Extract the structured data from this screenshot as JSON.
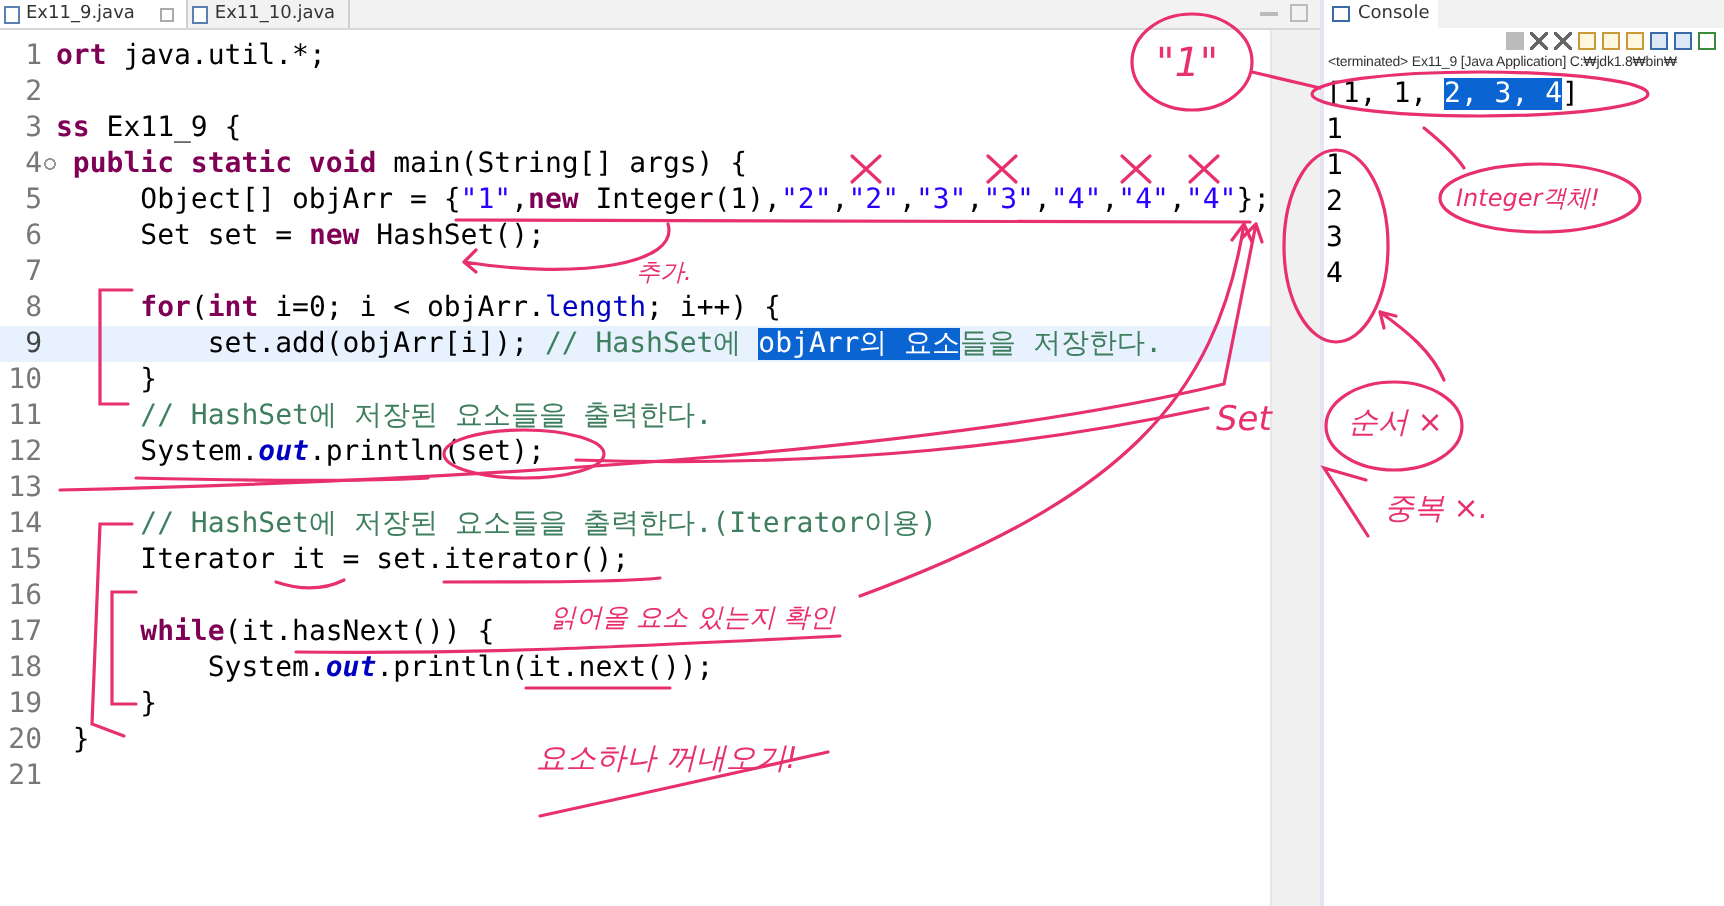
{
  "editor": {
    "tabs": [
      {
        "label": "Ex11_9.java",
        "selected": true,
        "closable": true
      },
      {
        "label": "Ex11_10.java",
        "selected": false,
        "closable": false
      }
    ],
    "lines": [
      {
        "number": "1",
        "current": false,
        "foldable": false,
        "tokens": [
          {
            "kind": "keyword",
            "text": "ort"
          },
          {
            "kind": "plain",
            "text": " java.util.*;"
          }
        ]
      },
      {
        "number": "2",
        "current": false,
        "foldable": false
      },
      {
        "number": "3",
        "current": false,
        "foldable": false,
        "tokens": [
          {
            "kind": "keyword",
            "text": "ss"
          },
          {
            "kind": "plain",
            "text": " Ex11_9 {"
          }
        ]
      },
      {
        "number": "4",
        "current": false,
        "foldable": true,
        "tokens": [
          {
            "kind": "keyword",
            "text": " public static void"
          },
          {
            "kind": "plain",
            "text": " main(String[] args) {"
          }
        ]
      },
      {
        "number": "5",
        "current": false,
        "foldable": false,
        "tokens": [
          {
            "kind": "plain",
            "text": "     Object[] objArr = {"
          },
          {
            "kind": "string",
            "text": "\"1\""
          },
          {
            "kind": "plain",
            "text": ","
          },
          {
            "kind": "keyword",
            "text": "new"
          },
          {
            "kind": "plain",
            "text": " Integer(1),"
          },
          {
            "kind": "string",
            "text": "\"2\""
          },
          {
            "kind": "plain",
            "text": ","
          },
          {
            "kind": "string",
            "text": "\"2\""
          },
          {
            "kind": "plain",
            "text": ","
          },
          {
            "kind": "string",
            "text": "\"3\""
          },
          {
            "kind": "plain",
            "text": ","
          },
          {
            "kind": "string",
            "text": "\"3\""
          },
          {
            "kind": "plain",
            "text": ","
          },
          {
            "kind": "string",
            "text": "\"4\""
          },
          {
            "kind": "plain",
            "text": ","
          },
          {
            "kind": "string",
            "text": "\"4\""
          },
          {
            "kind": "plain",
            "text": ","
          },
          {
            "kind": "string",
            "text": "\"4\""
          },
          {
            "kind": "plain",
            "text": "};"
          }
        ]
      },
      {
        "number": "6",
        "current": false,
        "foldable": false,
        "tokens": [
          {
            "kind": "plain",
            "text": "     Set set = "
          },
          {
            "kind": "keyword",
            "text": "new"
          },
          {
            "kind": "plain",
            "text": " HashSet();"
          }
        ]
      },
      {
        "number": "7",
        "current": false,
        "foldable": false
      },
      {
        "number": "8",
        "current": false,
        "foldable": false,
        "tokens": [
          {
            "kind": "keyword",
            "text": "     for"
          },
          {
            "kind": "plain",
            "text": "("
          },
          {
            "kind": "keyword",
            "text": "int"
          },
          {
            "kind": "plain",
            "text": " i=0; i < objArr."
          },
          {
            "kind": "field",
            "text": "length"
          },
          {
            "kind": "plain",
            "text": "; i++) {"
          }
        ]
      },
      {
        "number": "9",
        "current": true,
        "foldable": false,
        "tokens": [
          {
            "kind": "plain",
            "text": "         set.add(objArr[i]); "
          },
          {
            "kind": "comment",
            "text": "// HashSet에 "
          },
          {
            "kind": "selection",
            "text": "objArr의 요소"
          },
          {
            "kind": "comment",
            "text": "들을 저장한다."
          }
        ]
      },
      {
        "number": "10",
        "current": false,
        "foldable": false,
        "tokens": [
          {
            "kind": "plain",
            "text": "     }"
          }
        ]
      },
      {
        "number": "11",
        "current": false,
        "foldable": false,
        "tokens": [
          {
            "kind": "comment",
            "text": "     // HashSet에 저장된 요소들을 출력한다."
          }
        ]
      },
      {
        "number": "12",
        "current": false,
        "foldable": false,
        "tokens": [
          {
            "kind": "plain",
            "text": "     System."
          },
          {
            "kind": "static",
            "text": "out"
          },
          {
            "kind": "plain",
            "text": ".println(set);"
          }
        ]
      },
      {
        "number": "13",
        "current": false,
        "foldable": false
      },
      {
        "number": "14",
        "current": false,
        "foldable": false,
        "tokens": [
          {
            "kind": "comment",
            "text": "     // HashSet에 저장된 요소들을 출력한다.(Iterator이용)"
          }
        ]
      },
      {
        "number": "15",
        "current": false,
        "foldable": false,
        "tokens": [
          {
            "kind": "plain",
            "text": "     Iterator it = set.iterator();"
          }
        ]
      },
      {
        "number": "16",
        "current": false,
        "foldable": false
      },
      {
        "number": "17",
        "current": false,
        "foldable": false,
        "tokens": [
          {
            "kind": "keyword",
            "text": "     while"
          },
          {
            "kind": "plain",
            "text": "(it.hasNext()) {"
          }
        ]
      },
      {
        "number": "18",
        "current": false,
        "foldable": false,
        "tokens": [
          {
            "kind": "plain",
            "text": "         System."
          },
          {
            "kind": "static",
            "text": "out"
          },
          {
            "kind": "plain",
            "text": ".println(it.next());"
          }
        ]
      },
      {
        "number": "19",
        "current": false,
        "foldable": false,
        "tokens": [
          {
            "kind": "plain",
            "text": "     }"
          }
        ]
      },
      {
        "number": "20",
        "current": false,
        "foldable": false,
        "tokens": [
          {
            "kind": "plain",
            "text": " }"
          }
        ]
      },
      {
        "number": "21",
        "current": false,
        "foldable": false
      }
    ]
  },
  "console": {
    "tab": "Console",
    "status": "<terminated> Ex11_9 [Java Application] C:₩jdk1.8₩bin₩",
    "output": [
      {
        "tokens": [
          {
            "kind": "plain",
            "text": "[1, 1, "
          },
          {
            "kind": "selection",
            "text": "2, 3, 4"
          },
          {
            "kind": "plain",
            "text": "]"
          }
        ]
      },
      {
        "tokens": [
          {
            "kind": "plain",
            "text": "1"
          }
        ]
      },
      {
        "tokens": [
          {
            "kind": "plain",
            "text": "1"
          }
        ]
      },
      {
        "tokens": [
          {
            "kind": "plain",
            "text": "2"
          }
        ]
      },
      {
        "tokens": [
          {
            "kind": "plain",
            "text": "3"
          }
        ]
      },
      {
        "tokens": [
          {
            "kind": "plain",
            "text": "4"
          }
        ]
      }
    ]
  },
  "annotations": [
    {
      "text": "\"1\""
    },
    {
      "text": "추가."
    },
    {
      "text": "Integer객체!"
    },
    {
      "text": "Set"
    },
    {
      "text": "순서 ×"
    },
    {
      "text": "중복 ×."
    },
    {
      "text": "읽어올 요소 있는지 확인"
    },
    {
      "text": "요소하나 꺼내오기!"
    }
  ]
}
